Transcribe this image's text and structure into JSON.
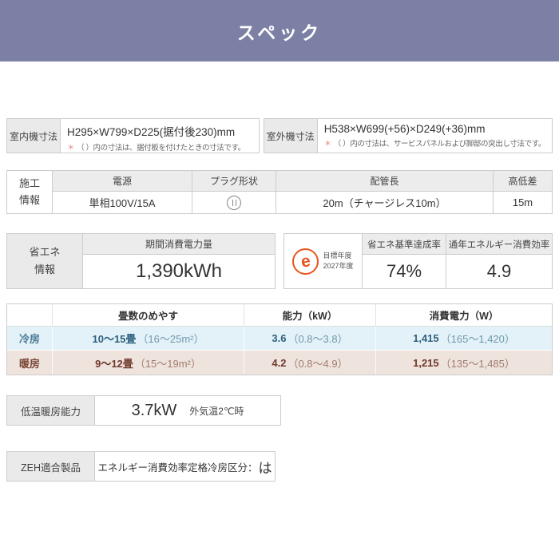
{
  "header": {
    "title": "スペック"
  },
  "dimensions": {
    "indoor": {
      "label": "室内機寸法",
      "value": "H295×W799×D225(据付後230)mm",
      "note_mark": "＊",
      "note": "（ ）内の寸法は、据付板を付けたときの寸法です。"
    },
    "outdoor": {
      "label": "室外機寸法",
      "value": "H538×W699(+56)×D249(+36)mm",
      "note_mark": "＊",
      "note": "（ ）内の寸法は、サービスパネルおよび脚部の突出し寸法です。"
    }
  },
  "construction": {
    "label_line1": "施工",
    "label_line2": "情報",
    "power_header": "電源",
    "power_value": "単相100V/15A",
    "plug_header": "プラグ形状",
    "pipe_header": "配管長",
    "pipe_value": "20m（チャージレス10m）",
    "height_header": "高低差",
    "height_value": "15m"
  },
  "energy": {
    "label_line1": "省エネ",
    "label_line2": "情報",
    "period_header": "期間消費電力量",
    "period_value": "1,390kWh",
    "mark_letter": "e",
    "mark_line1": "目標年度",
    "mark_line2": "2027年度",
    "achievement_header": "省エネ基準達成率",
    "achievement_value": "74%",
    "apf_header": "通年エネルギー消費効率",
    "apf_value": "4.9"
  },
  "performance": {
    "headers": {
      "tatami": "畳数のめやす",
      "capacity": "能力（kW）",
      "power": "消費電力（W）"
    },
    "rows": [
      {
        "label": "冷房",
        "tatami_main": "10〜15畳",
        "tatami_sub": "（16〜25m²）",
        "capacity_main": "3.6",
        "capacity_sub": "（0.8〜3.8）",
        "power_main": "1,415",
        "power_sub": "（165〜1,420）"
      },
      {
        "label": "暖房",
        "tatami_main": "9〜12畳",
        "tatami_sub": "（15〜19m²）",
        "capacity_main": "4.2",
        "capacity_sub": "（0.8〜4.9）",
        "power_main": "1,215",
        "power_sub": "（135〜1,485）"
      }
    ]
  },
  "low_temp": {
    "label": "低温暖房能力",
    "value": "3.7kW",
    "condition": "外気温2℃時"
  },
  "zeh": {
    "label": "ZEH適合製品",
    "text": "エネルギー消費効率定格冷房区分：",
    "grade": "は"
  },
  "colors": {
    "header_band": "#7B80A4",
    "emark_orange": "#E8541E",
    "cooling_row_bg": "#E3F2F8",
    "heating_row_bg": "#EFE3DE",
    "cooling_text": "#4A7B96",
    "heating_text": "#7A4636",
    "note_mark": "#E38383"
  }
}
